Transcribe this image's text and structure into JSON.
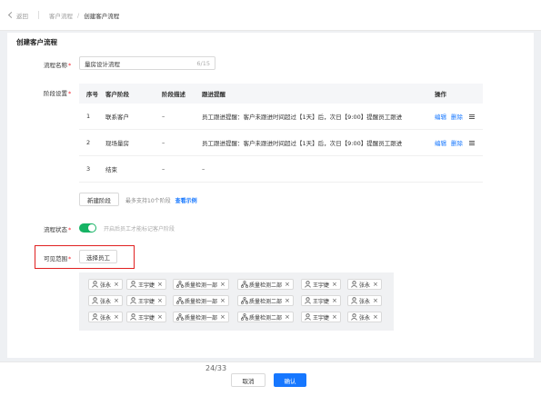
{
  "breadcrumb": {
    "back": "返回",
    "parent": "客户流程",
    "separator": "/",
    "current": "创建客户流程"
  },
  "page_title": "创建客户流程",
  "form": {
    "name_label": "流程名称",
    "name_value": "量房设计流程",
    "name_count": "6/15",
    "stages_label": "阶段设置",
    "status_label": "流程状态",
    "status_on": true,
    "status_hint": "开启后员工才能标记客户阶段",
    "scope_label": "可见范围",
    "required_mark": "*"
  },
  "table": {
    "headers": [
      "序号",
      "客户阶段",
      "阶段描述",
      "跟进提醒",
      "操作"
    ],
    "rows": [
      {
        "no": "1",
        "stage": "联系客户",
        "desc": "–",
        "remind": "员工跟进提醒：客户未跟进时间超过【1天】后，次日【9:00】提醒员工跟进",
        "edit": "编辑",
        "delete": "删除"
      },
      {
        "no": "2",
        "stage": "现场量房",
        "desc": "–",
        "remind": "员工跟进提醒：客户未跟进时间超过【1天】后，次日【9:00】提醒员工跟进",
        "edit": "编辑",
        "delete": "删除"
      },
      {
        "no": "3",
        "stage": "结束",
        "desc": "–",
        "remind": "–"
      }
    ]
  },
  "new_stage": {
    "button": "新建阶段",
    "hint": "最多支持10个阶段",
    "example_link": "查看示例"
  },
  "scope": {
    "choose_button": "选择员工",
    "tags": [
      {
        "label": "张永",
        "icon": "user-icon"
      },
      {
        "label": "王宇婕",
        "icon": "user-icon"
      },
      {
        "label": "质量检测一部",
        "icon": "org-icon"
      },
      {
        "label": "质量检测二部",
        "icon": "org-icon"
      },
      {
        "label": "王宇婕",
        "icon": "user-icon"
      },
      {
        "label": "张永",
        "icon": "user-icon"
      },
      {
        "label": "张永",
        "icon": "user-icon"
      },
      {
        "label": "王宇婕",
        "icon": "user-icon"
      },
      {
        "label": "质量检测一部",
        "icon": "org-icon"
      },
      {
        "label": "质量检测二部",
        "icon": "org-icon"
      },
      {
        "label": "王宇婕",
        "icon": "user-icon"
      },
      {
        "label": "张永",
        "icon": "user-icon"
      },
      {
        "label": "张永",
        "icon": "user-icon"
      },
      {
        "label": "王宇婕",
        "icon": "user-icon"
      },
      {
        "label": "质量检测一部",
        "icon": "org-icon"
      },
      {
        "label": "质量检测二部",
        "icon": "org-icon"
      },
      {
        "label": "王宇婕",
        "icon": "user-icon"
      },
      {
        "label": "张永",
        "icon": "user-icon"
      }
    ]
  },
  "footer": {
    "page": "24/33",
    "cancel": "取消",
    "confirm": "确认"
  },
  "colors": {
    "primary": "#1677ff",
    "toggle_on": "#16b364",
    "highlight_box": "#e02020",
    "required": "#f5222d"
  }
}
